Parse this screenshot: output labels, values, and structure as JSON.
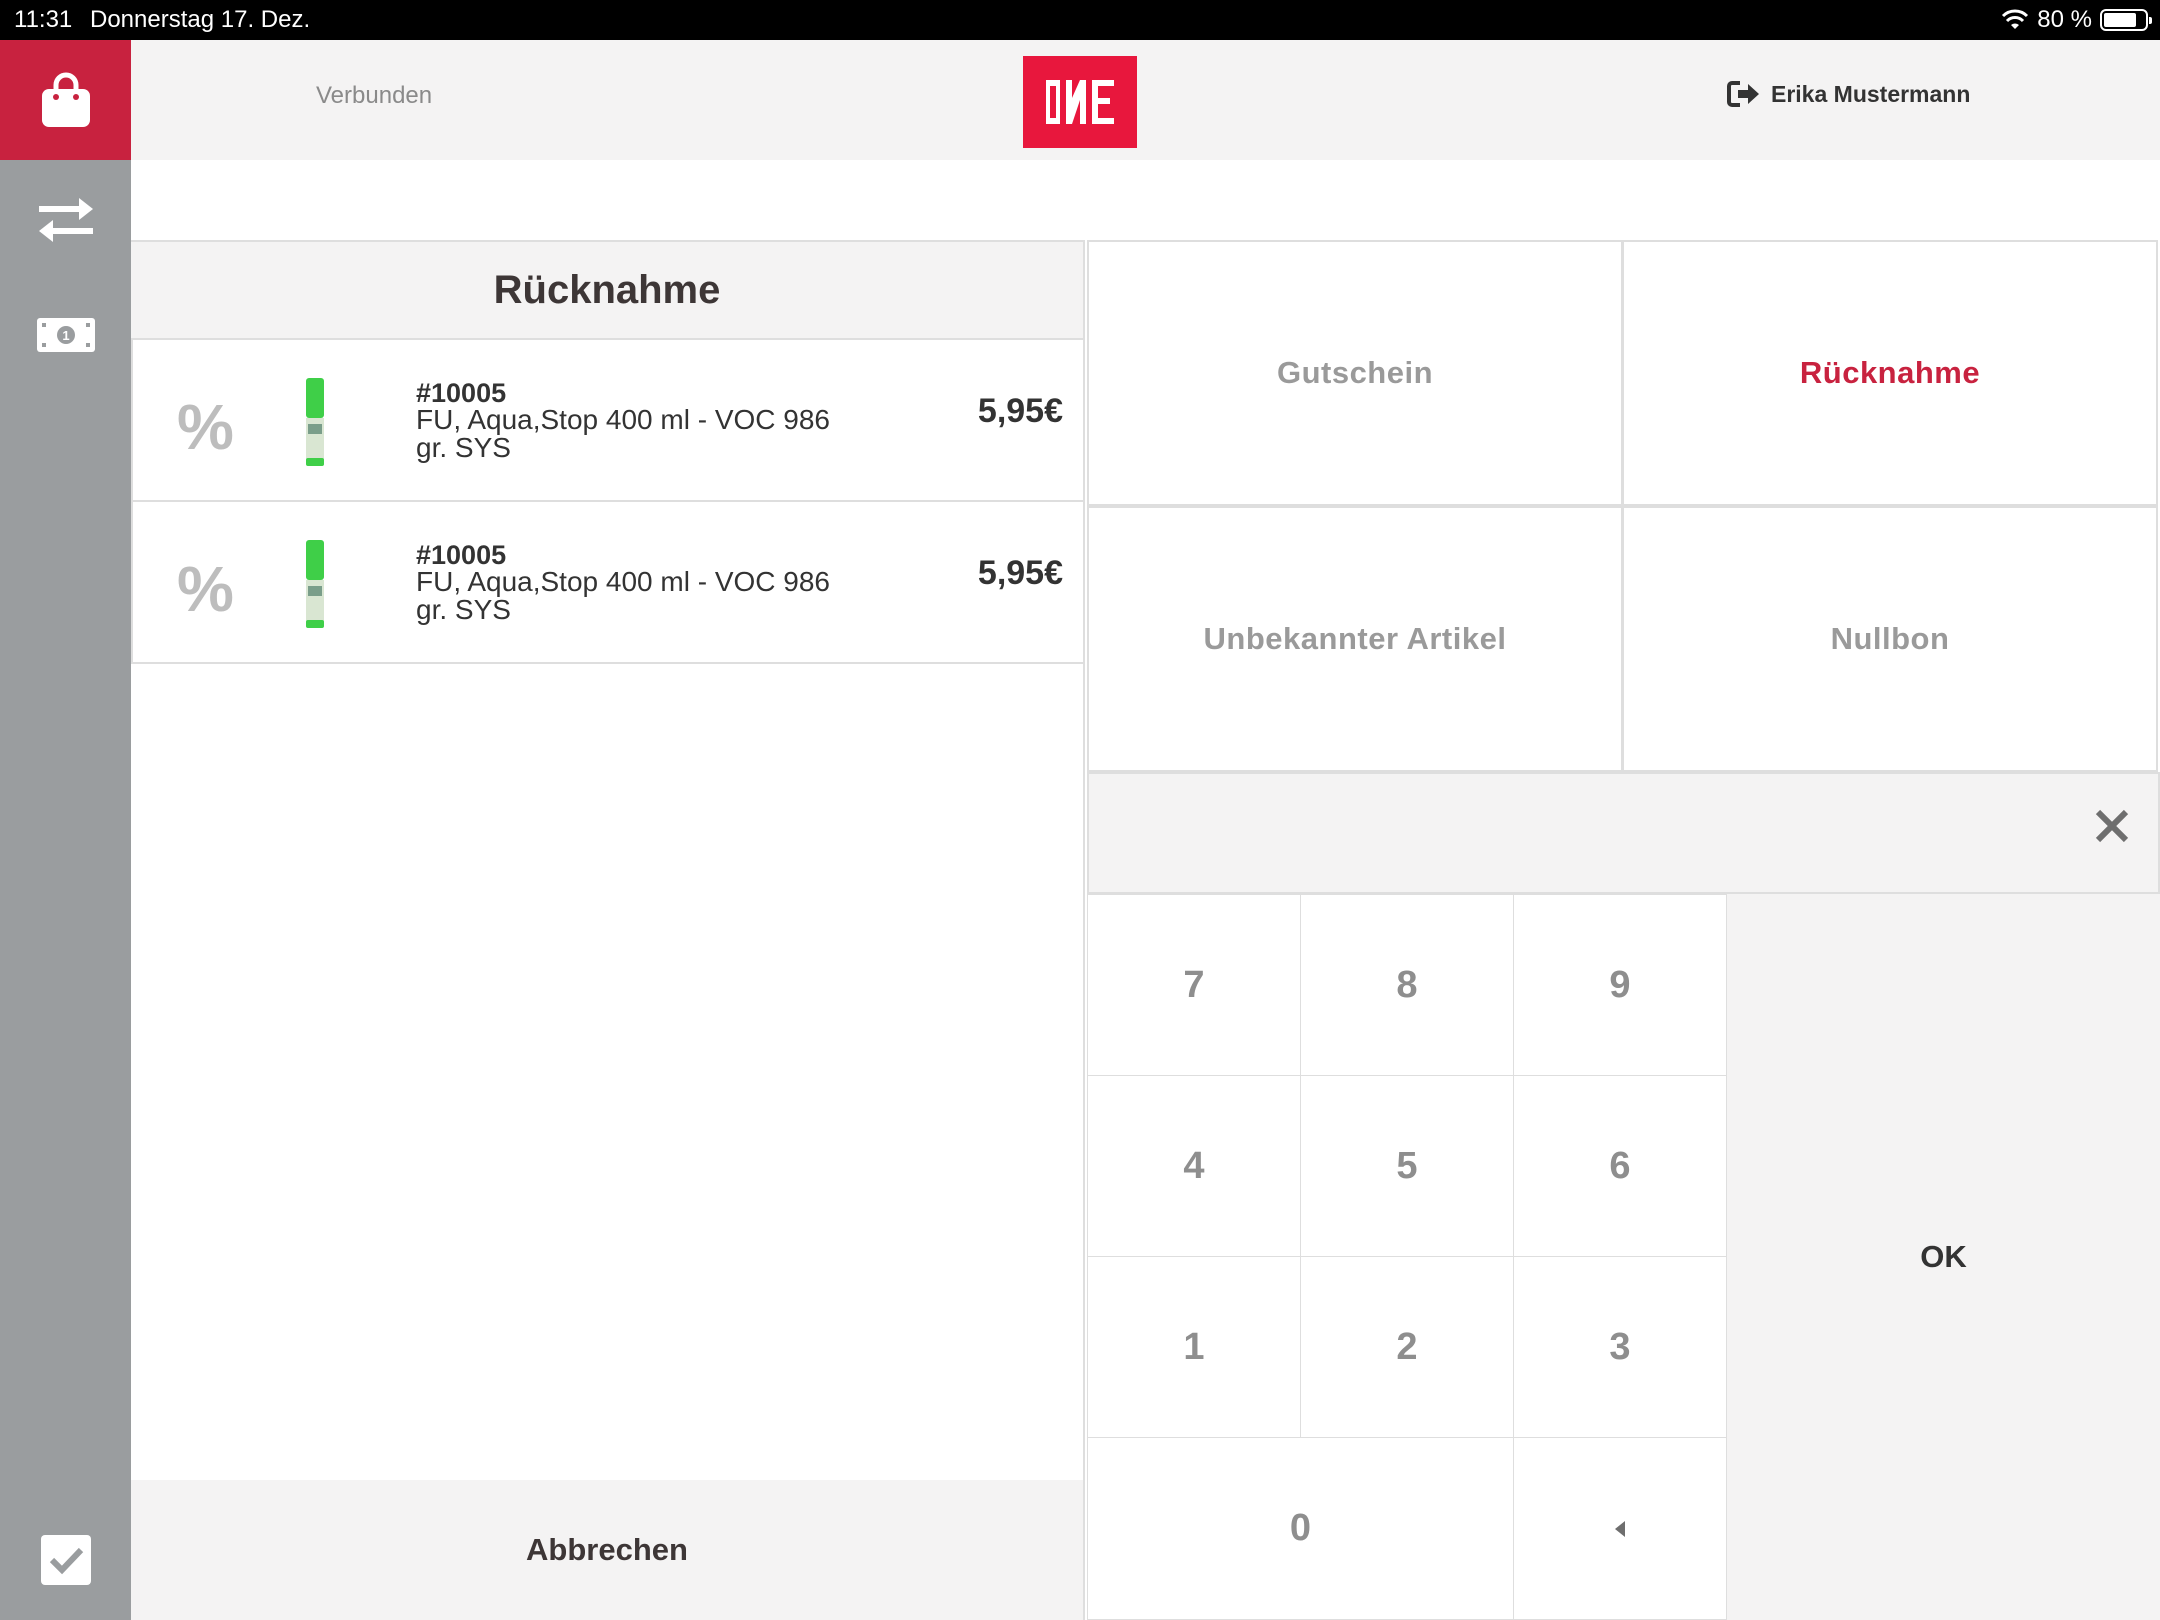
{
  "statusbar": {
    "time": "11:31",
    "date": "Donnerstag 17. Dez.",
    "battery": "80 %",
    "battery_level": 0.8
  },
  "sidebar": {
    "items": [
      {
        "icon": "shopping-bag-icon",
        "active": true
      },
      {
        "icon": "transfer-arrows-icon",
        "active": false
      },
      {
        "icon": "cash-icon",
        "active": false
      },
      {
        "icon": "checkmark-icon",
        "active": false
      }
    ]
  },
  "header": {
    "connection_status": "Verbunden",
    "user_name": "Erika Mustermann"
  },
  "cart": {
    "title": "Rücknahme",
    "items": [
      {
        "sku": "#10005",
        "name": "FU, Aqua,Stop 400 ml - VOC 986 gr. SYS",
        "price": "5,95€"
      },
      {
        "sku": "#10005",
        "name": "FU, Aqua,Stop 400 ml - VOC 986 gr. SYS",
        "price": "5,95€"
      }
    ],
    "cancel_label": "Abbrechen"
  },
  "actions": {
    "voucher": "Gutschein",
    "return": "Rücknahme",
    "unknown_item": "Unbekannter Artikel",
    "zero_receipt": "Nullbon"
  },
  "keypad": {
    "k7": "7",
    "k8": "8",
    "k9": "9",
    "k4": "4",
    "k5": "5",
    "k6": "6",
    "k1": "1",
    "k2": "2",
    "k3": "3",
    "k0": "0",
    "ok": "OK"
  },
  "colors": {
    "accent": "#c8223f",
    "brand_logo": "#e8173d",
    "sidebar": "#9a9d9f"
  }
}
